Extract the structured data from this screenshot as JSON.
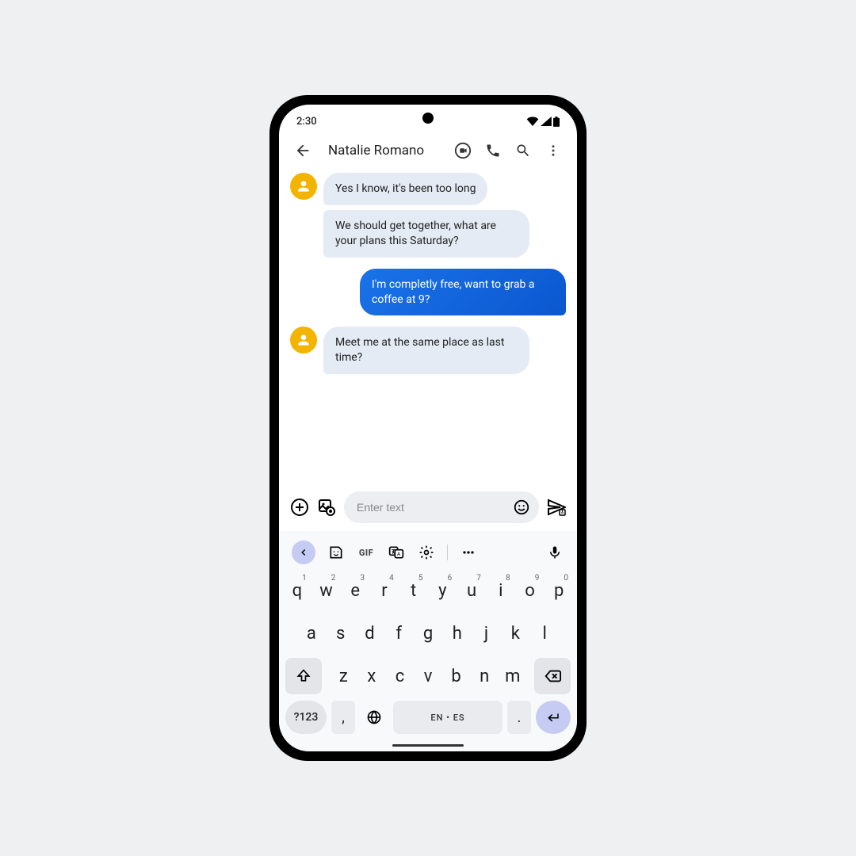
{
  "status": {
    "time": "2:30"
  },
  "header": {
    "contact_name": "Natalie Romano"
  },
  "messages": [
    {
      "from": "them",
      "text": "Yes I know, it's been too long"
    },
    {
      "from": "them",
      "text": "We should get together, what are your plans this Saturday?"
    },
    {
      "from": "me",
      "text": "I'm completly free, want to grab a coffee at 9?"
    },
    {
      "from": "them",
      "text": "Meet me at the same place as last time?"
    }
  ],
  "composer": {
    "placeholder": "Enter text"
  },
  "keyboard": {
    "gif_label": "GIF",
    "row1": [
      {
        "k": "q",
        "s": "1"
      },
      {
        "k": "w",
        "s": "2"
      },
      {
        "k": "e",
        "s": "3"
      },
      {
        "k": "r",
        "s": "4"
      },
      {
        "k": "t",
        "s": "5"
      },
      {
        "k": "y",
        "s": "6"
      },
      {
        "k": "u",
        "s": "7"
      },
      {
        "k": "i",
        "s": "8"
      },
      {
        "k": "o",
        "s": "9"
      },
      {
        "k": "p",
        "s": "0"
      }
    ],
    "row2": [
      "a",
      "s",
      "d",
      "f",
      "g",
      "h",
      "j",
      "k",
      "l"
    ],
    "row3": [
      "z",
      "x",
      "c",
      "v",
      "b",
      "n",
      "m"
    ],
    "symbols_label": "?123",
    "comma": ",",
    "period": ".",
    "space_label": "EN • ES"
  }
}
